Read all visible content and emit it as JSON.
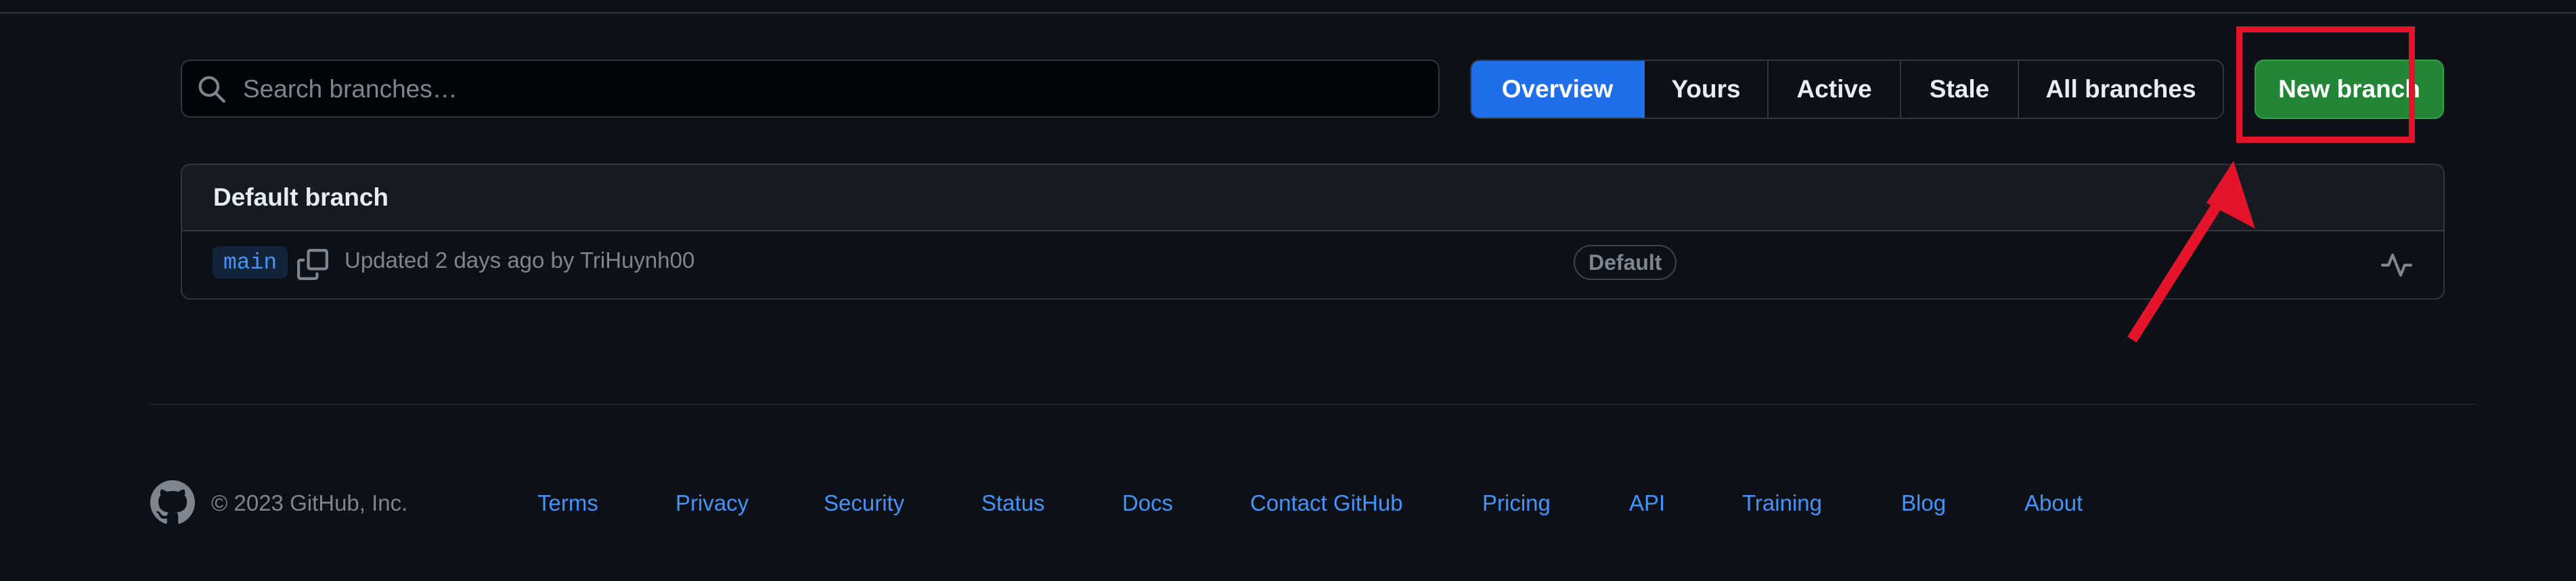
{
  "search": {
    "placeholder": "Search branches…"
  },
  "tabs": [
    {
      "label": "Overview",
      "selected": true
    },
    {
      "label": "Yours",
      "selected": false
    },
    {
      "label": "Active",
      "selected": false
    },
    {
      "label": "Stale",
      "selected": false
    },
    {
      "label": "All branches",
      "selected": false
    }
  ],
  "new_branch_label": "New branch",
  "default_section": {
    "title": "Default branch",
    "branch": {
      "name": "main",
      "updated_text": "Updated 2 days ago by ",
      "author": "TriHuynh00",
      "badge": "Default"
    }
  },
  "footer": {
    "copyright": "© 2023 GitHub, Inc.",
    "links": [
      "Terms",
      "Privacy",
      "Security",
      "Status",
      "Docs",
      "Contact GitHub",
      "Pricing",
      "API",
      "Training",
      "Blog",
      "About"
    ]
  },
  "colors": {
    "background": "#0d1117",
    "accent": "#1f6feb",
    "new_branch": "#238636",
    "highlight_box": "#e5142a"
  },
  "icons": [
    "search-icon",
    "copy-icon",
    "activity-icon",
    "github-logo-icon"
  ]
}
